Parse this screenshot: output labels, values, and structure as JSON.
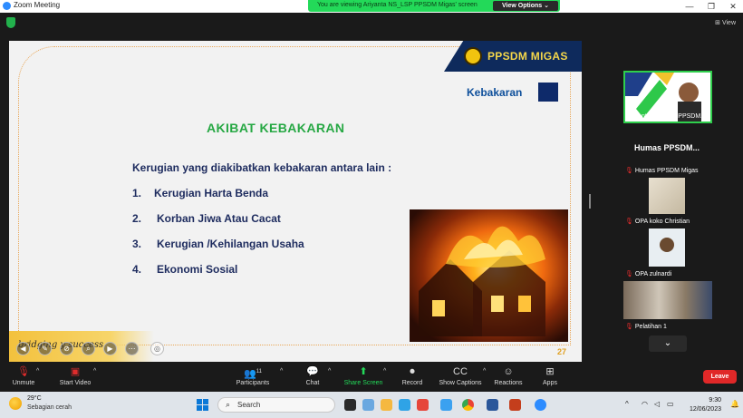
{
  "window": {
    "title": "Zoom Meeting",
    "controls": [
      "—",
      "❐",
      "✕"
    ],
    "banner_text": "You are viewing Ariyanta NS_LSP PPSDM Migas' screen",
    "view_options": "View Options",
    "view_label": "View"
  },
  "slide": {
    "logo_text": "PPSDM MIGAS",
    "section": "Kebakaran",
    "heading": "AKIBAT KEBAKARAN",
    "intro": "Kerugian yang diakibatkan kebakaran antara lain :",
    "items": [
      {
        "num": "1.",
        "text": "Kerugian Harta Benda"
      },
      {
        "num": "2.",
        "text": "Korban Jiwa Atau Cacat"
      },
      {
        "num": "3.",
        "text": "Kerugian /Kehilangan Usaha"
      },
      {
        "num": "4.",
        "text": "Ekonomi Sosial"
      }
    ],
    "footer": "bridging y  success",
    "page_number": "27"
  },
  "participants": [
    {
      "name": "Ariyanta NS_LSP PPSDM..."
    },
    {
      "name": "Humas PPSDM Migas",
      "display": "Humas  PPSDM..."
    },
    {
      "name": "OPA koko Christian"
    },
    {
      "name": "OPA zulnardi"
    },
    {
      "name": "Pelatihan 1"
    }
  ],
  "toolbar": {
    "unmute": "Unmute",
    "start_video": "Start Video",
    "participants": "Participants",
    "participants_count": "11",
    "chat": "Chat",
    "share_screen": "Share Screen",
    "record": "Record",
    "show_captions": "Show Captions",
    "reactions": "Reactions",
    "apps": "Apps",
    "leave": "Leave"
  },
  "taskbar": {
    "temperature": "29°C",
    "weather": "Sebagian cerah",
    "search_placeholder": "Search",
    "time": "9:30",
    "date": "12/06/2023"
  },
  "colors": {
    "banner": "#23d959",
    "heading": "#27a844",
    "text": "#1d2b5e",
    "leave": "#e02828",
    "navy": "#0e2a5c"
  }
}
